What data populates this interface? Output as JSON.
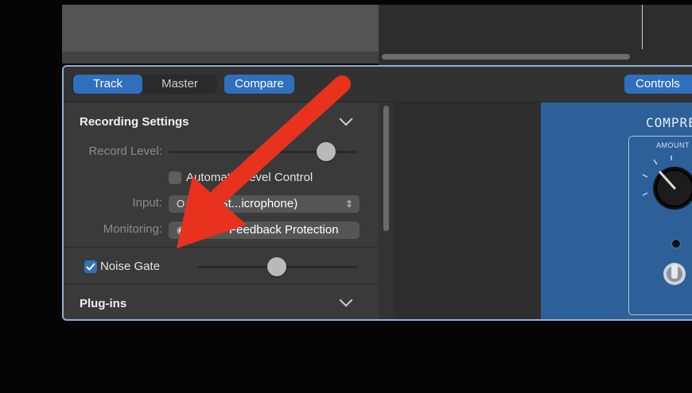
{
  "toolbar": {
    "track_label": "Track",
    "master_label": "Master",
    "compare_label": "Compare",
    "controls_label": "Controls"
  },
  "recording_settings": {
    "title": "Recording Settings",
    "record_level_label": "Record Level:",
    "record_level_value": 0.85,
    "automatic_level_control_label": "Automatic Level Control",
    "automatic_level_control_checked": false,
    "input_label": "Input:",
    "input_value": "Yeti St...icrophone)",
    "monitoring_label": "Monitoring:",
    "monitoring_value": "Feedback Protection"
  },
  "noise_gate": {
    "label": "Noise Gate",
    "checked": true,
    "level": 0.48
  },
  "plugins": {
    "title": "Plug-ins"
  },
  "compressor": {
    "title": "COMPRE",
    "amount_label": "AMOUNT"
  },
  "colors": {
    "accent": "#2f6fbe",
    "panel_border": "#8fb0d9",
    "plugin_bg": "#2d5f98",
    "arrow": "#e8321e"
  },
  "annotation": {
    "arrow_icon": "red-arrow-icon"
  }
}
